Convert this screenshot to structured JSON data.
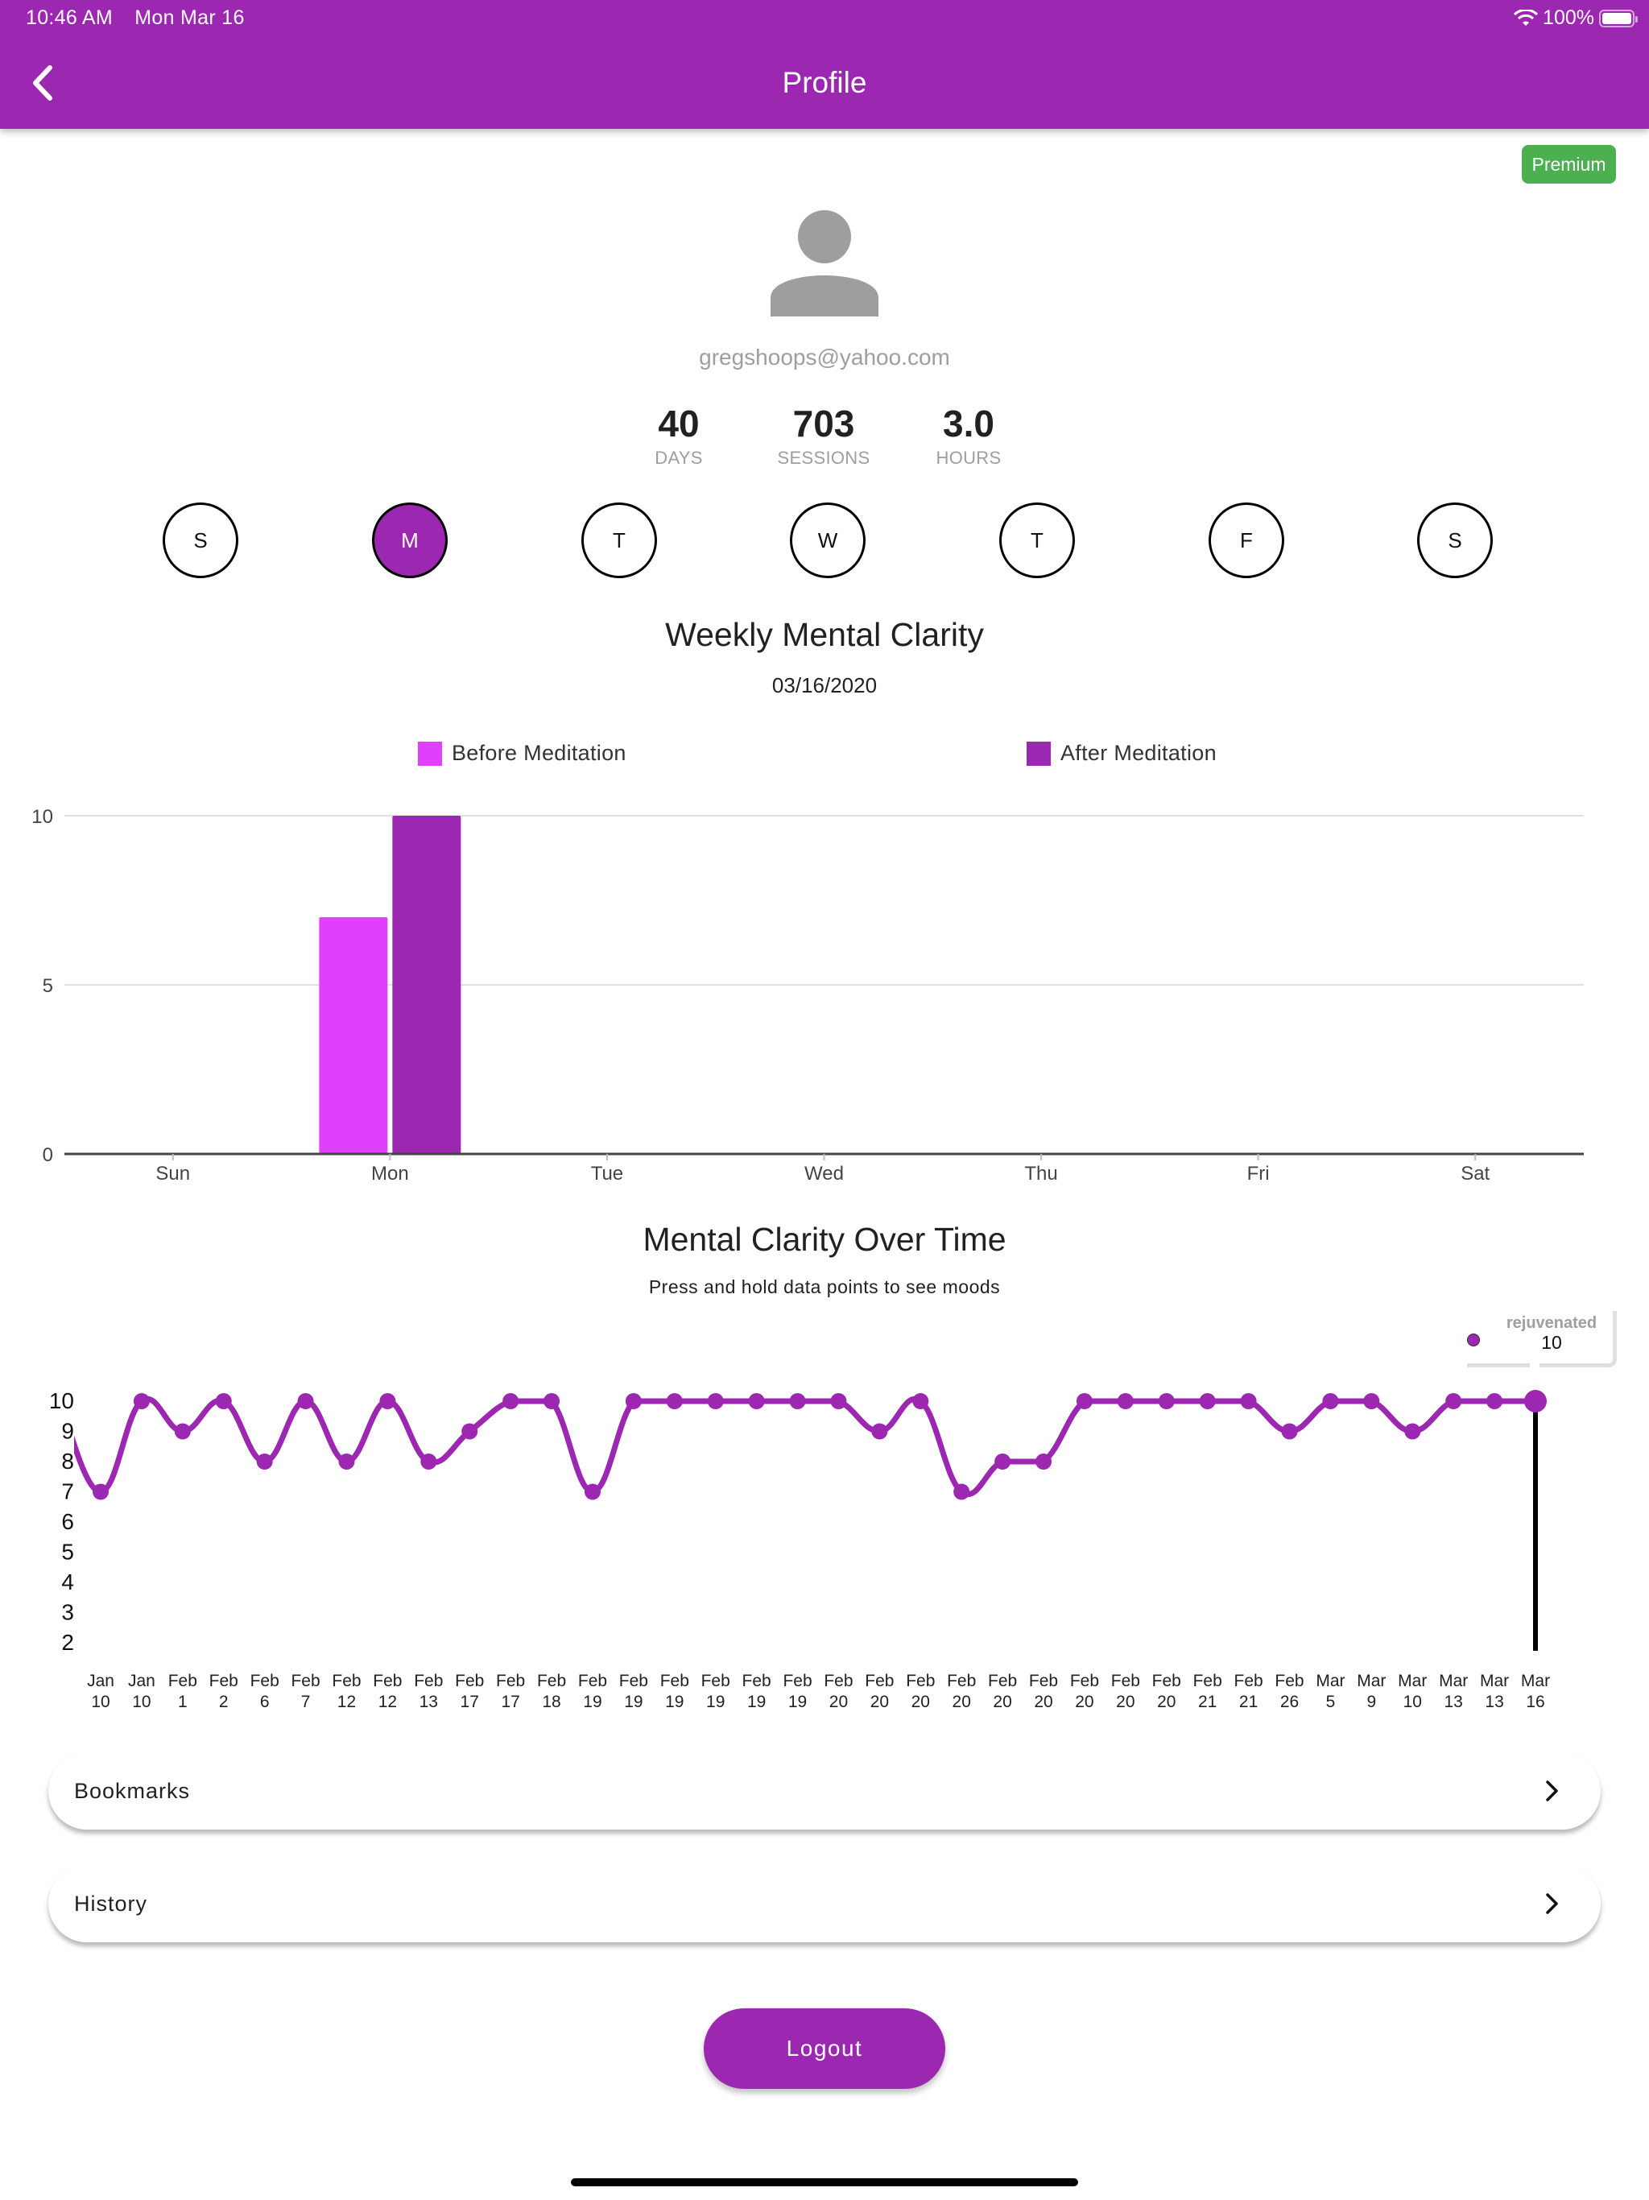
{
  "status_bar": {
    "time": "10:46 AM",
    "date": "Mon Mar 16",
    "battery": "100%"
  },
  "header": {
    "title": "Profile",
    "back_icon": "chevron-left-icon"
  },
  "badge": {
    "label": "Premium",
    "color": "#4caf50"
  },
  "profile": {
    "avatar_icon": "person-icon",
    "email": "gregshoops@yahoo.com",
    "stats": [
      {
        "value": "40",
        "label": "DAYS"
      },
      {
        "value": "703",
        "label": "SESSIONS"
      },
      {
        "value": "3.0",
        "label": "HOURS"
      }
    ]
  },
  "day_selector": {
    "days": [
      {
        "label": "S",
        "selected": false
      },
      {
        "label": "M",
        "selected": true
      },
      {
        "label": "T",
        "selected": false
      },
      {
        "label": "W",
        "selected": false
      },
      {
        "label": "T",
        "selected": false
      },
      {
        "label": "F",
        "selected": false
      },
      {
        "label": "S",
        "selected": false
      }
    ]
  },
  "colors": {
    "primary": "#9c27b0",
    "before": "#e040fb",
    "after": "#9c27b0"
  },
  "chart_data": [
    {
      "type": "bar",
      "title": "Weekly Mental Clarity",
      "subtitle": "03/16/2020",
      "categories": [
        "Sun",
        "Mon",
        "Tue",
        "Wed",
        "Thu",
        "Fri",
        "Sat"
      ],
      "series": [
        {
          "name": "Before Meditation",
          "color": "#e040fb",
          "values": [
            0,
            7,
            0,
            0,
            0,
            0,
            0
          ]
        },
        {
          "name": "After Meditation",
          "color": "#9c27b0",
          "values": [
            0,
            10,
            0,
            0,
            0,
            0,
            0
          ]
        }
      ],
      "yticks": [
        "0",
        "5",
        "10"
      ],
      "ylim": [
        0,
        10
      ],
      "grid": true,
      "legend": "top"
    },
    {
      "type": "line",
      "title": "Mental Clarity Over Time",
      "subtitle": "Press and hold data points to see moods",
      "x": [
        [
          "Jan",
          "10"
        ],
        [
          "Jan",
          "10"
        ],
        [
          "Feb",
          "1"
        ],
        [
          "Feb",
          "2"
        ],
        [
          "Feb",
          "6"
        ],
        [
          "Feb",
          "7"
        ],
        [
          "Feb",
          "12"
        ],
        [
          "Feb",
          "12"
        ],
        [
          "Feb",
          "13"
        ],
        [
          "Feb",
          "17"
        ],
        [
          "Feb",
          "17"
        ],
        [
          "Feb",
          "18"
        ],
        [
          "Feb",
          "19"
        ],
        [
          "Feb",
          "19"
        ],
        [
          "Feb",
          "19"
        ],
        [
          "Feb",
          "19"
        ],
        [
          "Feb",
          "19"
        ],
        [
          "Feb",
          "19"
        ],
        [
          "Feb",
          "20"
        ],
        [
          "Feb",
          "20"
        ],
        [
          "Feb",
          "20"
        ],
        [
          "Feb",
          "20"
        ],
        [
          "Feb",
          "20"
        ],
        [
          "Feb",
          "20"
        ],
        [
          "Feb",
          "20"
        ],
        [
          "Feb",
          "20"
        ],
        [
          "Feb",
          "20"
        ],
        [
          "Feb",
          "21"
        ],
        [
          "Feb",
          "21"
        ],
        [
          "Feb",
          "26"
        ],
        [
          "Mar",
          "5"
        ],
        [
          "Mar",
          "9"
        ],
        [
          "Mar",
          "10"
        ],
        [
          "Mar",
          "13"
        ],
        [
          "Mar",
          "13"
        ],
        [
          "Mar",
          "16"
        ]
      ],
      "series": [
        {
          "name": "Mental Clarity",
          "color": "#9c27b0",
          "values": [
            7,
            10,
            9,
            10,
            8,
            10,
            8,
            10,
            8,
            9,
            10,
            10,
            7,
            10,
            10,
            10,
            10,
            10,
            10,
            9,
            10,
            7,
            8,
            8,
            10,
            10,
            10,
            10,
            10,
            9,
            10,
            10,
            9,
            10,
            10,
            10
          ]
        }
      ],
      "yticks": [
        "2",
        "3",
        "4",
        "5",
        "6",
        "7",
        "8",
        "9",
        "10"
      ],
      "ylim": [
        2,
        10
      ],
      "grid": false,
      "selected_index": 35,
      "tooltip": {
        "label": "rejuvenated",
        "value": "10"
      }
    }
  ],
  "nav": [
    {
      "label": "Bookmarks",
      "icon": "chevron-right-icon"
    },
    {
      "label": "History",
      "icon": "chevron-right-icon"
    }
  ],
  "logout": {
    "label": "Logout"
  }
}
